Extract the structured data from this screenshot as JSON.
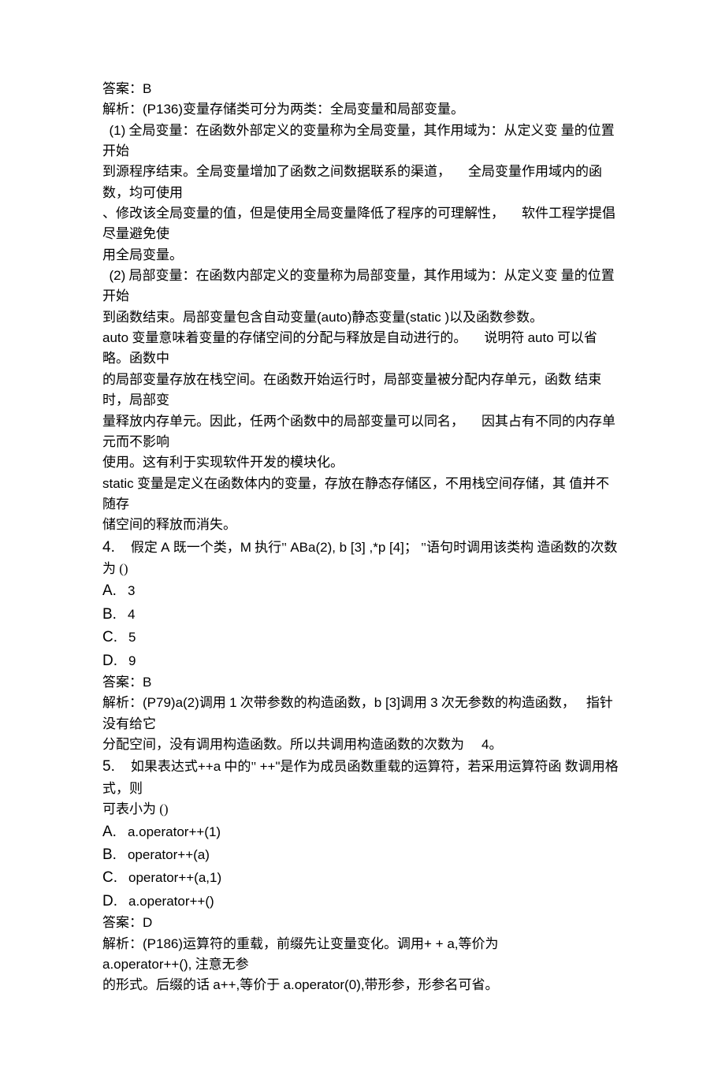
{
  "q3": {
    "answer_label": "答案：",
    "answer_value": "B",
    "explain_prefix": "解析：",
    "explain_ref": "(P136)",
    "p1": "变量存储类可分为两类：全局变量和局部变量。",
    "p2a": "(1)",
    "p2b": " 全局变量：在函数外部定义的变量称为全局变量，其作用域为：从定义变 量的位置开始",
    "p3": "到源程序结束。全局变量增加了函数之间数据联系的渠道，",
    "p3b": "全局变量作用域内的函数，均可使用",
    "p4": "、修改该全局变量的值，但是使用全局变量降低了程序的可理解性，",
    "p4b": "软件工程学提倡尽量避免使",
    "p5": "用全局变量。",
    "p6a": "(2)",
    "p6b": " 局部变量：在函数内部定义的变量称为局部变量，其作用域为：从定义变 量的位置开始",
    "p7a": "到函数结束。局部变量包含自动变量",
    "p7b": "(auto)",
    "p7c": "静态变量",
    "p7d": "(static )",
    "p7e": "以及函数参数。",
    "p8a": "auto",
    "p8b": " 变量意味着变量的存储空间的分配与释放是自动进行的。",
    "p8c": "说明符 ",
    "p8d": "auto",
    "p8e": " 可以省略。函数中",
    "p9": "的局部变量存放在栈空间。在函数开始运行时，局部变量被分配内存单元，函数 结束时，局部变",
    "p10": "量释放内存单元。因此，任两个函数中的局部变量可以同名，",
    "p10b": "因其占有不同的内存单元而不影响",
    "p11": "使用。这有利于实现软件开发的模块化。",
    "p12a": "static",
    "p12b": " 变量是定义在函数体内的变量，存放在静态存储区，不用栈空间存储，其 值并不随存",
    "p13": "储空间的释放而消失。"
  },
  "q4": {
    "num": "4.",
    "stem_a": "假定 ",
    "stem_b": "A",
    "stem_c": " 既一个类，",
    "stem_d": "M",
    "stem_e": " 执行\" ",
    "stem_f": "ABa(2), b [3] ,*p [4]",
    "stem_g": "； \"语句时调用该类构 造函数的次数",
    "stem_h": "为 ()",
    "opts": {
      "A": "3",
      "B": "4",
      "C": "5",
      "D": "9"
    },
    "answer_label": "答案：",
    "answer_value": "B",
    "explain_prefix": "解析：",
    "explain_ref": "(P79)a(2)",
    "exp_a": "调用 ",
    "exp_b": "1",
    "exp_c": " 次带参数的构造函数，",
    "exp_d": "b [3]",
    "exp_e": "调用 ",
    "exp_f": "3",
    "exp_g": " 次无参数的构造函数，",
    "exp_h": "指针没有给它",
    "exp2_a": "分配空间，没有调用构造函数。所以共调用构造函数的次数为",
    "exp2_b": "4",
    "exp2_c": "。"
  },
  "q5": {
    "num": "5.",
    "stem_a": "如果表达式",
    "stem_b": "++a",
    "stem_c": " 中的\" ",
    "stem_d": "++\"",
    "stem_e": "是作为成员函数重载的运算符，若采用运算符函 数调用格式，则",
    "stem_f": "可表小为 ()",
    "opts": {
      "A": "a.operator++(1)",
      "B": "operator++(a)",
      "C": "operator++(a,1)",
      "D": "a.operator++()"
    },
    "answer_label": "答案：",
    "answer_value": "D",
    "explain_prefix": "解析：",
    "explain_ref": "(P186)",
    "exp_a": "运算符的重载，前缀先让变量变化。调用",
    "exp_b": "+ + a,",
    "exp_c": "等价为",
    "exp2_a": "a.operator++(),",
    "exp2_b": " 注意无参",
    "exp3_a": "的形式。后缀的话 ",
    "exp3_b": "a++,",
    "exp3_c": "等价于 ",
    "exp3_d": "a.operator(0),",
    "exp3_e": "带形参，形参名可省。"
  }
}
